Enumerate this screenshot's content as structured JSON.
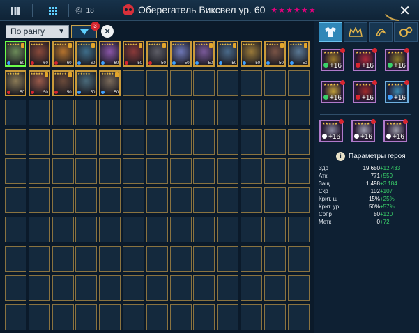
{
  "topbar": {
    "counter": "18",
    "title": "Оберегатель Виксвел ур. 60",
    "stars": "★★★★★★",
    "close": "✕"
  },
  "filters": {
    "sort_value": "По рангу",
    "filter_badge": "3"
  },
  "grid": {
    "heroes": [
      {
        "lvl": "60",
        "color": "#6d8c5a",
        "affinity": "#3ea0ff"
      },
      {
        "lvl": "60",
        "color": "#8a4a3b",
        "affinity": "#d8262f"
      },
      {
        "lvl": "60",
        "color": "#b6742e",
        "affinity": "#d8262f"
      },
      {
        "lvl": "60",
        "color": "#3f6e8a",
        "affinity": "#3ea0ff"
      },
      {
        "lvl": "60",
        "color": "#8a56a8",
        "affinity": "#3ea0ff"
      },
      {
        "lvl": "50",
        "color": "#8a3a3a",
        "affinity": "#d8262f"
      },
      {
        "lvl": "50",
        "color": "#5d5d66",
        "affinity": "#d8262f"
      },
      {
        "lvl": "50",
        "color": "#6f78b8",
        "affinity": "#3ea0ff"
      },
      {
        "lvl": "50",
        "color": "#7a5a9a",
        "affinity": "#3ea0ff"
      },
      {
        "lvl": "50",
        "color": "#4a6a8a",
        "affinity": "#3ea0ff"
      },
      {
        "lvl": "50",
        "color": "#9a7a3a",
        "affinity": "#3ea0ff"
      },
      {
        "lvl": "50",
        "color": "#7a5446",
        "affinity": "#3ea0ff"
      },
      {
        "lvl": "50",
        "color": "#5a7894",
        "affinity": "#3ea0ff"
      },
      {
        "lvl": "50",
        "color": "#8a7a56",
        "affinity": "#d8262f"
      },
      {
        "lvl": "50",
        "color": "#9a5a4a",
        "affinity": "#d8262f"
      },
      {
        "lvl": "50",
        "color": "#6a4a3a",
        "affinity": "#d8262f"
      },
      {
        "lvl": "50",
        "color": "#4a6a7a",
        "affinity": "#3ea0ff"
      },
      {
        "lvl": "50",
        "color": "#7a6a5a",
        "affinity": "#3ea0ff"
      }
    ]
  },
  "panel": {
    "tabs": [
      "tab-artifacts",
      "tab-masteries",
      "tab-skills",
      "tab-settings"
    ],
    "gear": [
      {
        "lvl": "+16",
        "color": "#9a7a2a",
        "set": "#3ad26a"
      },
      {
        "lvl": "+16",
        "color": "#b02a3a",
        "set": "#d8262f"
      },
      {
        "lvl": "+16",
        "color": "#8a7a2a",
        "set": "#3ad26a"
      },
      {
        "lvl": "+16",
        "color": "#c0a03a",
        "set": "#3ad26a"
      },
      {
        "lvl": "+16",
        "color": "#a02a2a",
        "set": "#d8262f"
      },
      {
        "lvl": "+16",
        "color": "#3a8ab0",
        "set": "#3ea0ff"
      },
      {
        "lvl": "+16",
        "color": "#8a8aa0",
        "set": "#ffffff"
      },
      {
        "lvl": "+16",
        "color": "#a0a0b0",
        "set": "#ffffff"
      },
      {
        "lvl": "+16",
        "color": "#9a9aa6",
        "set": "#ffffff"
      }
    ],
    "params_label": "Параметры героя",
    "stats": [
      {
        "label": "Здр",
        "value": "19 650",
        "bonus": "+12 433"
      },
      {
        "label": "Атк",
        "value": "771",
        "bonus": "+559"
      },
      {
        "label": "Защ",
        "value": "1 498",
        "bonus": "+3 184"
      },
      {
        "label": "Скр",
        "value": "102",
        "bonus": "+107"
      },
      {
        "label": "Крит. ш",
        "value": "15%",
        "bonus": "+25%"
      },
      {
        "label": "Крит. ур",
        "value": "50%",
        "bonus": "+57%"
      },
      {
        "label": "Сопр",
        "value": "50",
        "bonus": "+120"
      },
      {
        "label": "Метк",
        "value": "0",
        "bonus": "+72"
      }
    ]
  }
}
